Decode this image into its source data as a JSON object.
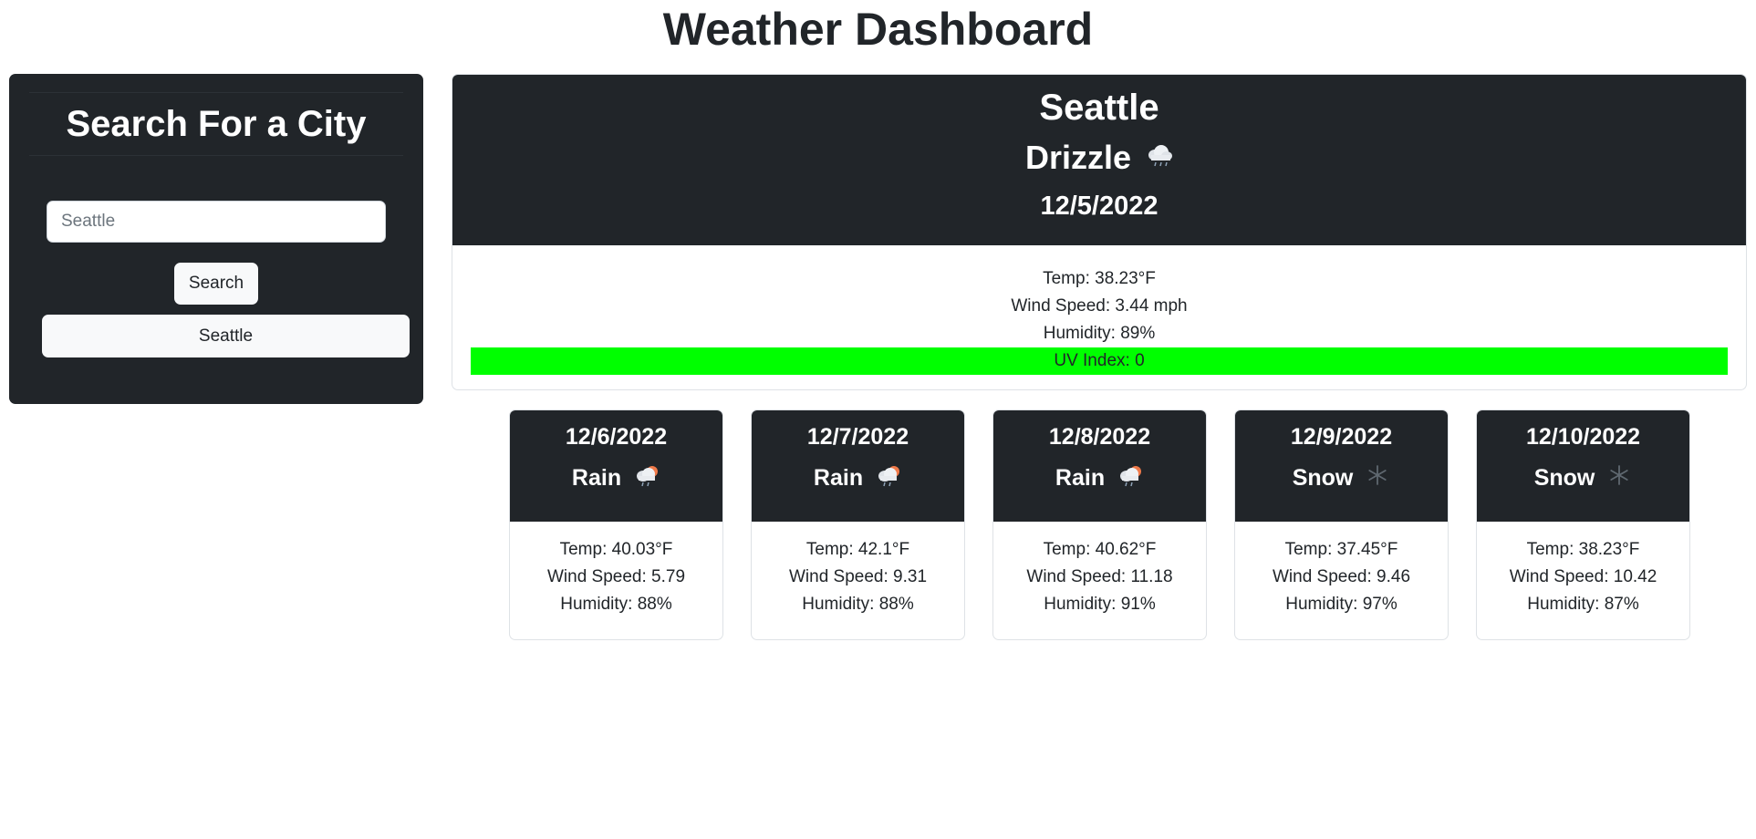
{
  "page": {
    "title": "Weather Dashboard"
  },
  "sidebar": {
    "heading": "Search For a City",
    "search_input": {
      "value": "",
      "placeholder": "Seattle"
    },
    "search_button_label": "Search",
    "history": [
      {
        "label": "Seattle"
      }
    ]
  },
  "current": {
    "city": "Seattle",
    "condition": "Drizzle",
    "icon": "cloud-drizzle-icon",
    "date": "12/5/2022",
    "temp": "Temp: 38.23°F",
    "wind": "Wind Speed: 3.44 mph",
    "humidity": "Humidity: 89%",
    "uv": "UV Index: 0",
    "uv_color": "#00ff00"
  },
  "forecast": [
    {
      "date": "12/6/2022",
      "condition": "Rain",
      "icon": "rain-icon",
      "temp": "Temp: 40.03°F",
      "wind": "Wind Speed: 5.79",
      "humidity": "Humidity: 88%"
    },
    {
      "date": "12/7/2022",
      "condition": "Rain",
      "icon": "rain-icon",
      "temp": "Temp: 42.1°F",
      "wind": "Wind Speed: 9.31",
      "humidity": "Humidity: 88%"
    },
    {
      "date": "12/8/2022",
      "condition": "Rain",
      "icon": "rain-icon",
      "temp": "Temp: 40.62°F",
      "wind": "Wind Speed: 11.18",
      "humidity": "Humidity: 91%"
    },
    {
      "date": "12/9/2022",
      "condition": "Snow",
      "icon": "snowflake-icon",
      "temp": "Temp: 37.45°F",
      "wind": "Wind Speed: 9.46",
      "humidity": "Humidity: 97%"
    },
    {
      "date": "12/10/2022",
      "condition": "Snow",
      "icon": "snowflake-icon",
      "temp": "Temp: 38.23°F",
      "wind": "Wind Speed: 10.42",
      "humidity": "Humidity: 87%"
    }
  ]
}
